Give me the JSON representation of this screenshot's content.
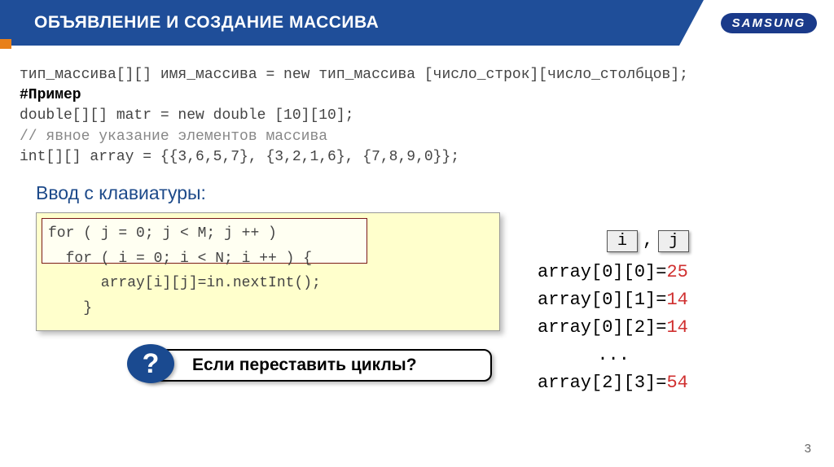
{
  "header": {
    "title": "ОБЪЯВЛЕНИЕ И СОЗДАНИЕ МАССИВА",
    "logo": "SAMSUNG"
  },
  "syntax": {
    "line": "тип_массива[][] имя_массива = new тип_массива [число_строк][число_столбцов];",
    "example_label": "#Пример",
    "example_code": "double[][] matr = new double [10][10];",
    "comment": "// явное указание элементов массива",
    "init_code": "int[][] array = {{3,6,5,7}, {3,2,1,6}, {7,8,9,0}};"
  },
  "keyboard": {
    "title": "Ввод с клавиатуры:",
    "line1": "for ( j = 0; j < M; j ++ )",
    "line2": "  for ( i = 0; i < N; i ++ ) {",
    "line3": "      array[i][j]=in.nextInt();",
    "line4": "    }"
  },
  "indices": {
    "i": "i",
    "sep": ",",
    "j": "j"
  },
  "output_rows": [
    {
      "left": "array[0][0]=",
      "val": "25"
    },
    {
      "left": "array[0][1]=",
      "val": "14"
    },
    {
      "left": "array[0][2]=",
      "val": "14"
    },
    {
      "left": "...",
      "val": ""
    },
    {
      "left": "array[2][3]=",
      "val": "54"
    }
  ],
  "question": {
    "mark": "?",
    "text": "Если переставить циклы?"
  },
  "page": "3"
}
